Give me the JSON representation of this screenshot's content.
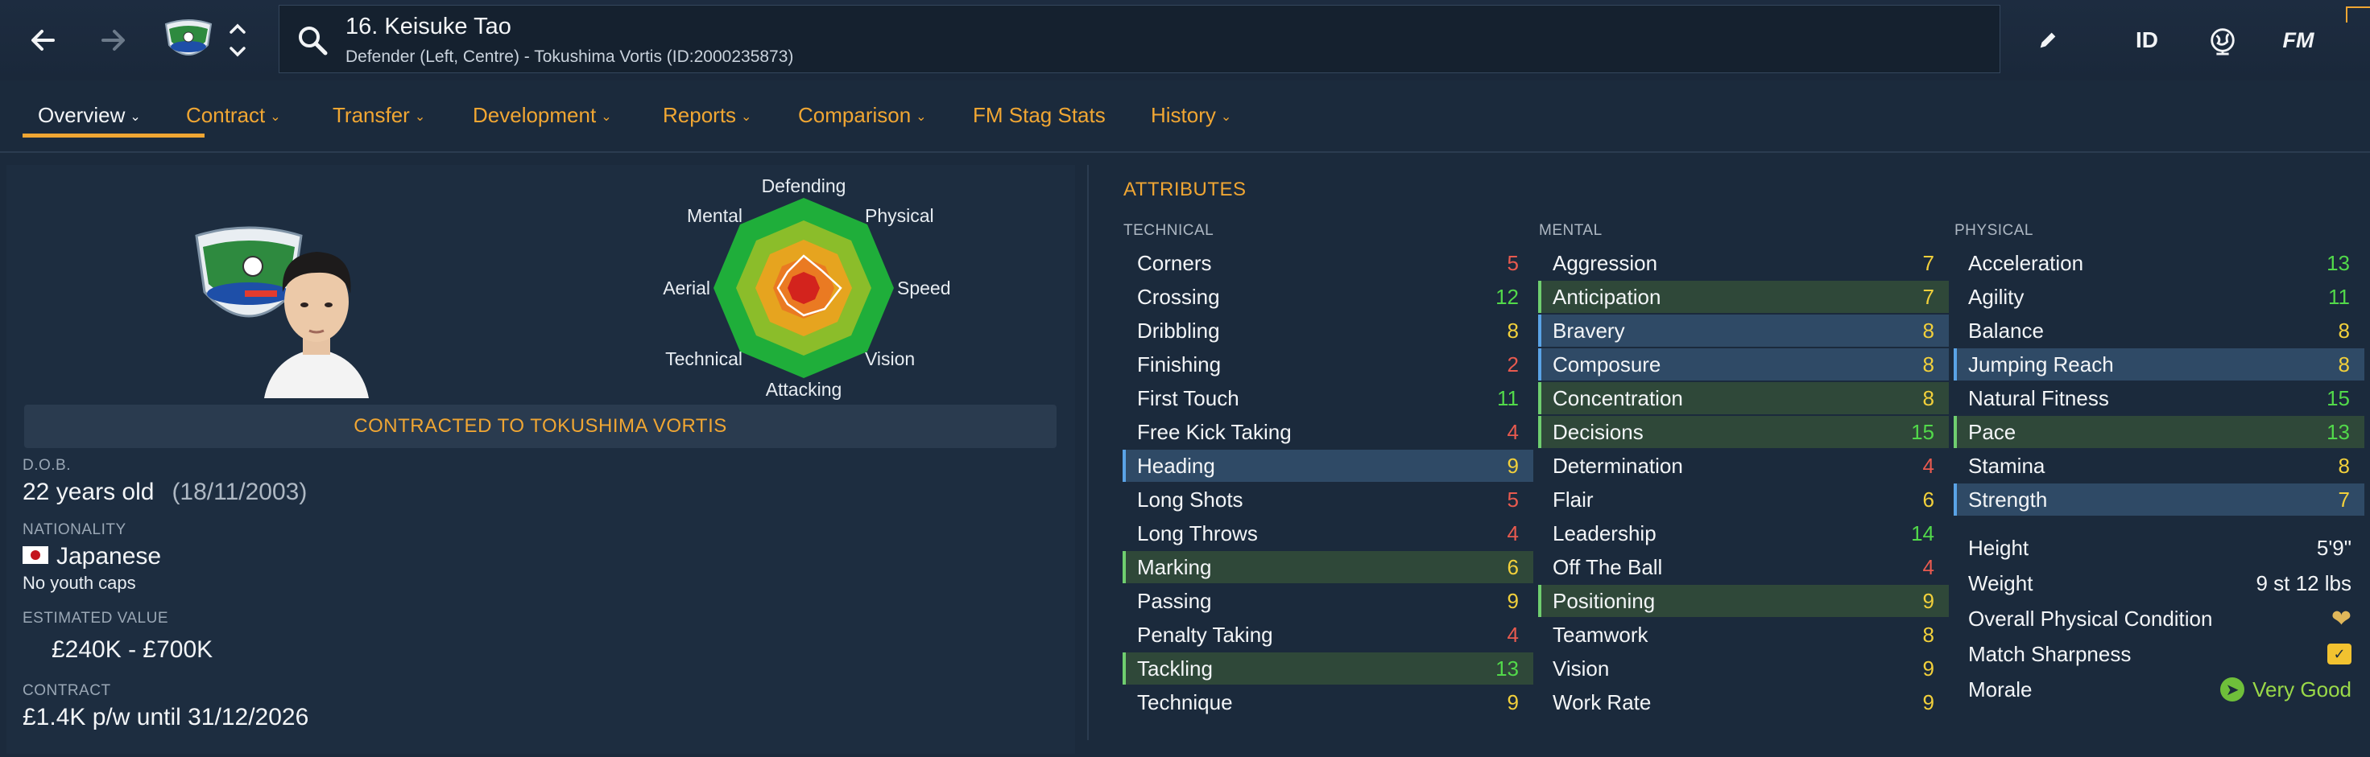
{
  "header": {
    "player_title": "16. Keisuke Tao",
    "player_subtitle": "Defender (Left, Centre) - Tokushima Vortis (ID:2000235873)",
    "icons": [
      "back-arrow-icon",
      "forward-arrow-icon",
      "club-badge-icon",
      "up-down-chevron-icon",
      "search-icon",
      "edit-pencil-icon",
      "id-icon",
      "globe-icon",
      "fm-logo-icon"
    ],
    "id_label": "ID",
    "fm_label": "FM"
  },
  "tabs": [
    {
      "label": "Overview",
      "dropdown": true
    },
    {
      "label": "Contract",
      "dropdown": true
    },
    {
      "label": "Transfer",
      "dropdown": true
    },
    {
      "label": "Development",
      "dropdown": true
    },
    {
      "label": "Reports",
      "dropdown": true
    },
    {
      "label": "Comparison",
      "dropdown": true
    },
    {
      "label": "FM Stag Stats",
      "dropdown": false
    },
    {
      "label": "History",
      "dropdown": true
    }
  ],
  "radar": {
    "labels": {
      "defending": "Defending",
      "physical": "Physical",
      "speed": "Speed",
      "vision": "Vision",
      "attacking": "Attacking",
      "technical": "Technical",
      "aerial": "Aerial",
      "mental": "Mental"
    }
  },
  "profile": {
    "contract_banner": "CONTRACTED TO TOKUSHIMA VORTIS",
    "dob_label": "D.O.B.",
    "age": "22 years old",
    "dob": "(18/11/2003)",
    "nationality_label": "NATIONALITY",
    "nationality": "Japanese",
    "youth_caps": "No youth caps",
    "value_label": "ESTIMATED VALUE",
    "value": "£240K - £700K",
    "contract_label": "CONTRACT",
    "contract": "£1.4K p/w until 31/12/2026"
  },
  "attributes": {
    "heading": "ATTRIBUTES",
    "technical_label": "TECHNICAL",
    "mental_label": "MENTAL",
    "physical_label": "PHYSICAL",
    "technical": [
      {
        "name": "Corners",
        "value": "5",
        "hl": ""
      },
      {
        "name": "Crossing",
        "value": "12",
        "hl": ""
      },
      {
        "name": "Dribbling",
        "value": "8",
        "hl": ""
      },
      {
        "name": "Finishing",
        "value": "2",
        "hl": ""
      },
      {
        "name": "First Touch",
        "value": "11",
        "hl": ""
      },
      {
        "name": "Free Kick Taking",
        "value": "4",
        "hl": ""
      },
      {
        "name": "Heading",
        "value": "9",
        "hl": "blue"
      },
      {
        "name": "Long Shots",
        "value": "5",
        "hl": ""
      },
      {
        "name": "Long Throws",
        "value": "4",
        "hl": ""
      },
      {
        "name": "Marking",
        "value": "6",
        "hl": "green"
      },
      {
        "name": "Passing",
        "value": "9",
        "hl": ""
      },
      {
        "name": "Penalty Taking",
        "value": "4",
        "hl": ""
      },
      {
        "name": "Tackling",
        "value": "13",
        "hl": "green"
      },
      {
        "name": "Technique",
        "value": "9",
        "hl": ""
      }
    ],
    "mental": [
      {
        "name": "Aggression",
        "value": "7",
        "hl": ""
      },
      {
        "name": "Anticipation",
        "value": "7",
        "hl": "green"
      },
      {
        "name": "Bravery",
        "value": "8",
        "hl": "blue"
      },
      {
        "name": "Composure",
        "value": "8",
        "hl": "blue"
      },
      {
        "name": "Concentration",
        "value": "8",
        "hl": "green"
      },
      {
        "name": "Decisions",
        "value": "15",
        "hl": "green"
      },
      {
        "name": "Determination",
        "value": "4",
        "hl": ""
      },
      {
        "name": "Flair",
        "value": "6",
        "hl": ""
      },
      {
        "name": "Leadership",
        "value": "14",
        "hl": ""
      },
      {
        "name": "Off The Ball",
        "value": "4",
        "hl": ""
      },
      {
        "name": "Positioning",
        "value": "9",
        "hl": "green"
      },
      {
        "name": "Teamwork",
        "value": "8",
        "hl": ""
      },
      {
        "name": "Vision",
        "value": "9",
        "hl": ""
      },
      {
        "name": "Work Rate",
        "value": "9",
        "hl": ""
      }
    ],
    "physical": [
      {
        "name": "Acceleration",
        "value": "13",
        "hl": ""
      },
      {
        "name": "Agility",
        "value": "11",
        "hl": ""
      },
      {
        "name": "Balance",
        "value": "8",
        "hl": ""
      },
      {
        "name": "Jumping Reach",
        "value": "8",
        "hl": "blue"
      },
      {
        "name": "Natural Fitness",
        "value": "15",
        "hl": ""
      },
      {
        "name": "Pace",
        "value": "13",
        "hl": "green"
      },
      {
        "name": "Stamina",
        "value": "8",
        "hl": ""
      },
      {
        "name": "Strength",
        "value": "7",
        "hl": "blue"
      }
    ],
    "physical_info": {
      "height_label": "Height",
      "height": "5'9\"",
      "weight_label": "Weight",
      "weight": "9 st 12 lbs",
      "condition_label": "Overall Physical Condition",
      "sharpness_label": "Match Sharpness",
      "morale_label": "Morale",
      "morale": "Very Good"
    }
  },
  "colors": {
    "accent": "#f0a633",
    "low": "#e85a4f",
    "mid": "#f2d03b",
    "high": "#52d94a",
    "highlight_blue": "#2f4a66",
    "highlight_green": "#2f4839"
  }
}
